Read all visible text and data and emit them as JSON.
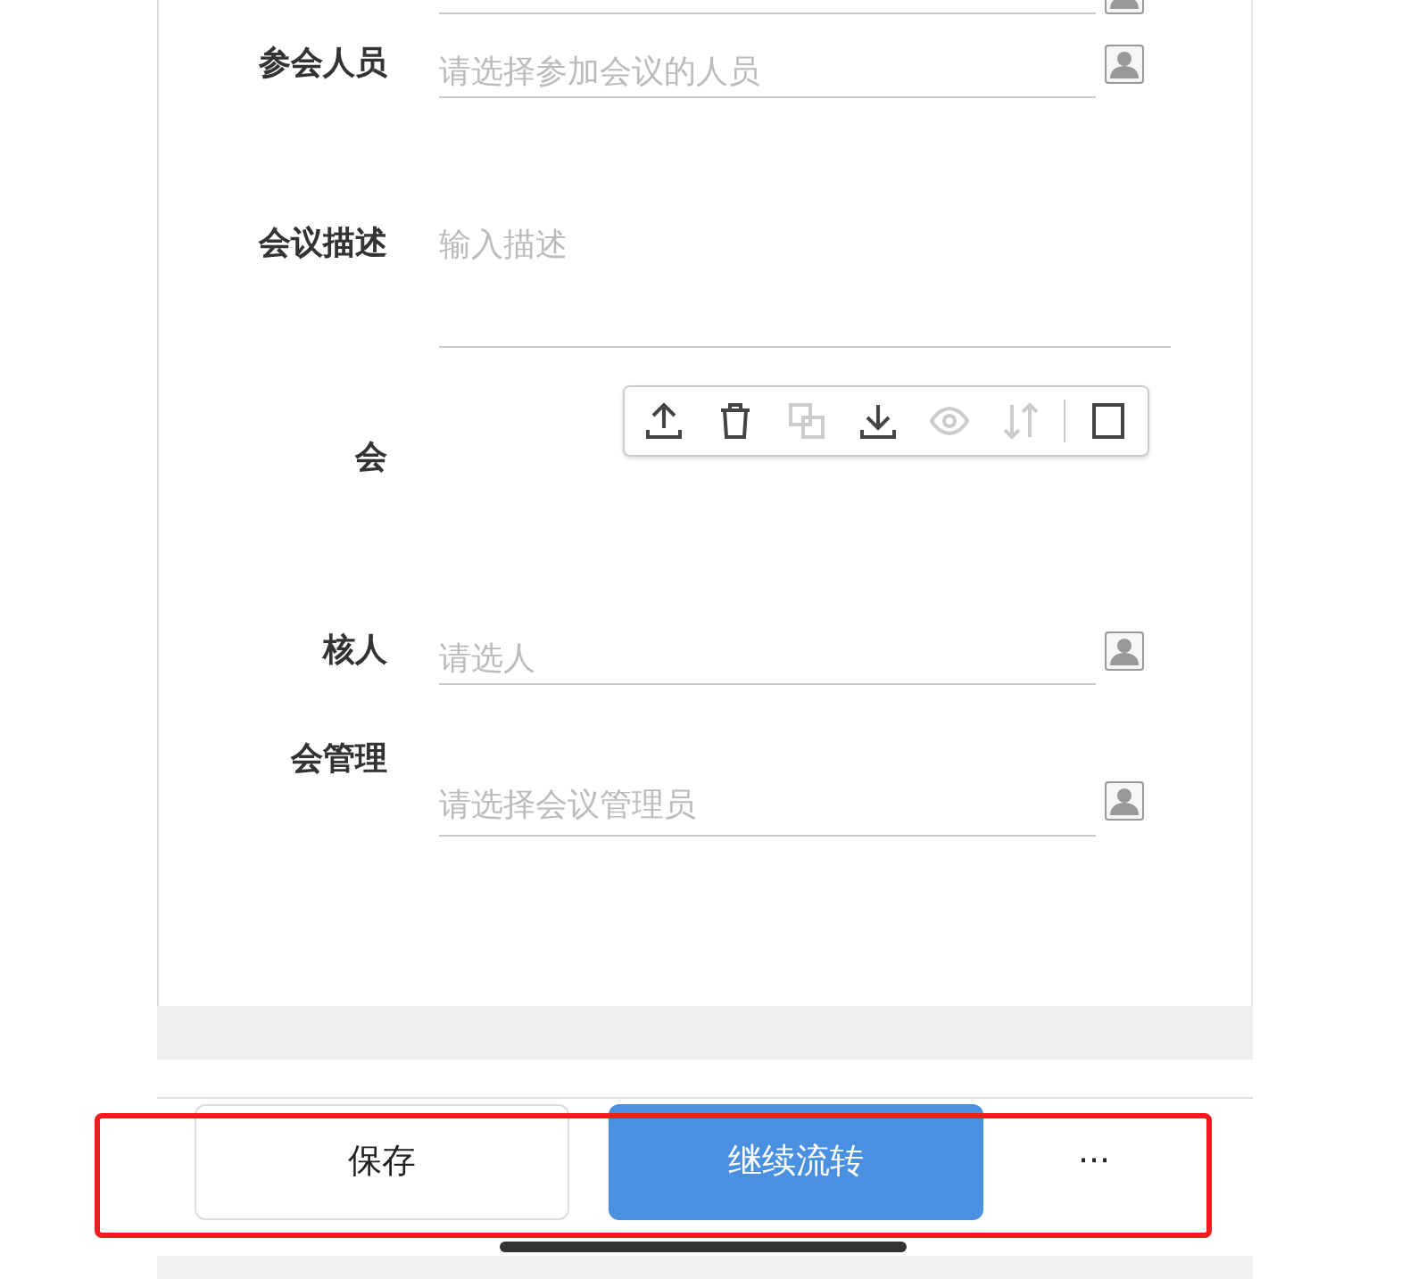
{
  "form": {
    "rows": [
      {
        "kind": "partial"
      },
      {
        "kind": "select",
        "label": "参会人员",
        "placeholder": "请选择参加会议的人员"
      },
      {
        "kind": "textarea",
        "label": "会议描述",
        "placeholder": "输入描述"
      },
      {
        "kind": "attachment",
        "label": "会",
        "tools": [
          {
            "disabled": false
          },
          {
            "disabled": false
          },
          {
            "disabled": true
          },
          {
            "disabled": false
          },
          {
            "disabled": true
          },
          {
            "disabled": true
          },
          {
            "disabled": false
          }
        ]
      },
      {
        "kind": "select",
        "label": "核人",
        "placeholder": "请选人"
      },
      {
        "kind": "select-offset",
        "label": "会管理",
        "placeholder": "请选择会议管理员"
      }
    ]
  },
  "actions": [
    {
      "kind": "secondary",
      "label": "保存"
    },
    {
      "kind": "primary",
      "label": "继续流转"
    },
    {
      "kind": "more",
      "label": "···"
    }
  ]
}
